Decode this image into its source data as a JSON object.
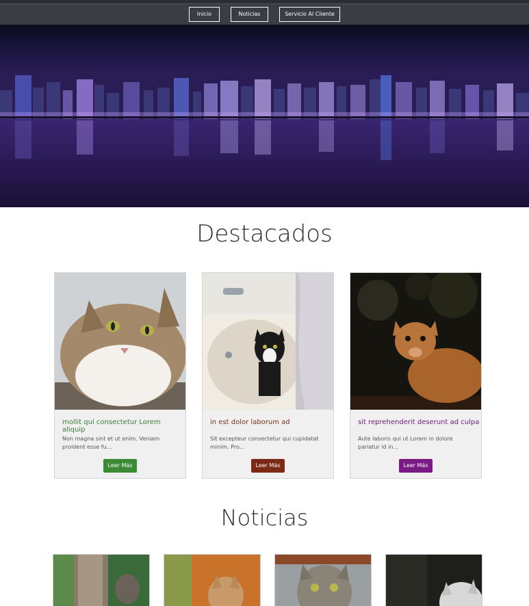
{
  "nav": {
    "items": [
      "Inicio",
      "Noticias",
      "Servicio Al Cliente"
    ]
  },
  "sections": {
    "featured_title": "Destacados",
    "news_title": "Noticias"
  },
  "cards": [
    {
      "title": "mollit qui consectetur Lorem aliquip",
      "text": "Non magna sint et ut enim. Veniam proident esse fu...",
      "button": "Leer Más",
      "accent": "#3c8a35"
    },
    {
      "title": "in est dolor laborum ad",
      "text": "Sit excepteur consectetur qui cupidatat minim. Pro...",
      "button": "Leer Más",
      "accent": "#7a2a15"
    },
    {
      "title": "sit reprehenderit deserunt ad culpa",
      "text": "Aute laboris qui ut Lorem in dolore pariatur id in...",
      "button": "Leer Más",
      "accent": "#7a1a85"
    }
  ],
  "colors": {
    "nav_bg": "#3a3d44",
    "hero_purple": "#2e1e5a"
  }
}
